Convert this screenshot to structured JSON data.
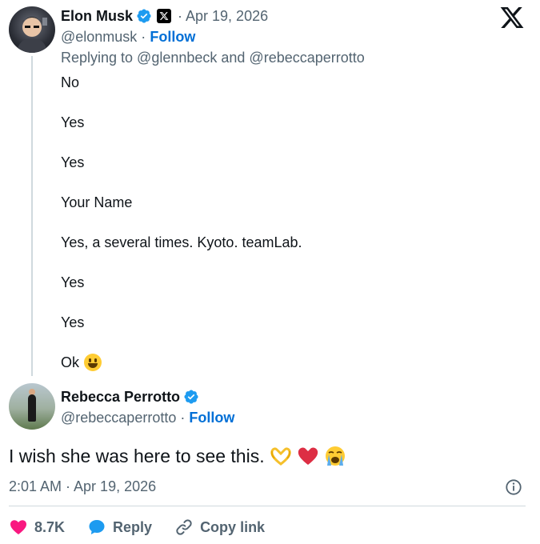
{
  "parent_tweet": {
    "author_name": "Elon Musk",
    "date": "· Apr 19, 2026",
    "handle": "@elonmusk ·",
    "follow_label": "Follow",
    "replying_to": "Replying to @glennbeck and @rebeccaperrotto",
    "lines": [
      "No",
      "Yes",
      "Yes",
      "Your Name",
      "Yes, a several times. Kyoto. teamLab.",
      "Yes",
      "Yes",
      "Ok"
    ]
  },
  "main_tweet": {
    "author_name": "Rebecca Perrotto",
    "handle": "@rebeccaperrotto ·",
    "follow_label": "Follow",
    "text": "I wish she was here to see this.",
    "timestamp": "2:01 AM · Apr 19, 2026"
  },
  "actions": {
    "likes": "8.7K",
    "reply_label": "Reply",
    "copy_link_label": "Copy link"
  },
  "icons": {
    "brand": "x-logo-icon",
    "verified": "verified-badge-icon",
    "affiliate": "x-affiliate-badge-icon",
    "info": "info-icon",
    "like": "heart-icon",
    "reply": "speech-bubble-icon",
    "link": "link-icon"
  },
  "colors": {
    "text_primary": "#0f1419",
    "text_secondary": "#536471",
    "link_blue": "#006fd6",
    "verified_blue": "#1d9bf0",
    "like_pink": "#f91880",
    "divider": "#cfd9de"
  }
}
